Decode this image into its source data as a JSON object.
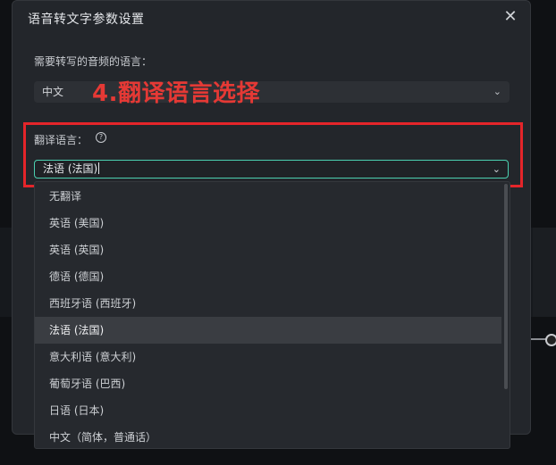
{
  "dialog": {
    "title": "语音转文字参数设置",
    "close_icon": "close-icon",
    "audio_language_label": "需要转写的音频的语言：",
    "audio_language_value": "中文",
    "translate_label": "翻译语言：",
    "help_glyph": "?",
    "translate_value": "法语 (法国)",
    "annotation": "4.翻译语言选择"
  },
  "dropdown": {
    "items": [
      "无翻译",
      "英语 (美国)",
      "英语 (英国)",
      "德语 (德国)",
      "西班牙语 (西班牙)",
      "法语 (法国)",
      "意大利语 (意大利)",
      "葡萄牙语 (巴西)",
      "日语 (日本)",
      "中文（简体，普通话）"
    ],
    "selected_index": 5
  },
  "colors": {
    "accent": "#4bd0b0",
    "annotation_red": "#e53935",
    "dialog_bg": "#23262b"
  }
}
